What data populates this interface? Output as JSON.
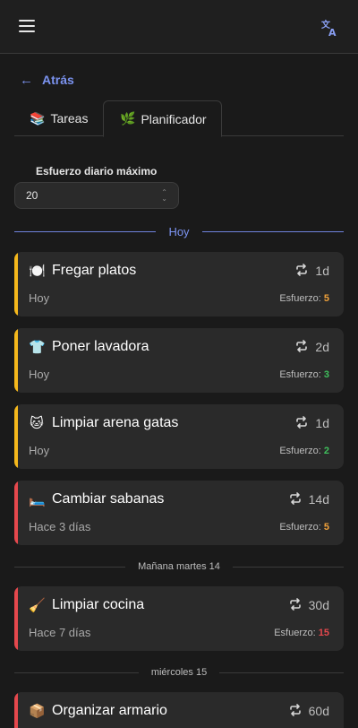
{
  "header": {
    "menu_icon": "hamburger-menu-icon",
    "translate_icon": "translate-icon"
  },
  "nav": {
    "back_label": "Atrás"
  },
  "tabs": [
    {
      "label": "Tareas",
      "icon": "books-icon"
    },
    {
      "label": "Planificador",
      "icon": "seedling-icon",
      "active": true
    }
  ],
  "effort": {
    "label": "Esfuerzo diario máximo",
    "value": "20"
  },
  "sections": [
    {
      "label": "Hoy"
    },
    {
      "label": "Mañana martes 14"
    },
    {
      "label": "miércoles 15"
    }
  ],
  "effort_prefix": "Esfuerzo:",
  "colors": {
    "accent": "#7b93f0",
    "bar_yellow": "#f5b81c",
    "bar_red": "#e5484d",
    "effort_orange": "#f0a13a",
    "effort_green": "#3fbf5c",
    "effort_red": "#e5484d"
  },
  "tasks": [
    {
      "emoji": "🍽️",
      "title": "Fregar platos",
      "freq": "1d",
      "when": "Hoy",
      "effort": "5",
      "bar": "#f5b81c",
      "effort_color": "#f0a13a"
    },
    {
      "emoji": "👕",
      "title": "Poner lavadora",
      "freq": "2d",
      "when": "Hoy",
      "effort": "3",
      "bar": "#f5b81c",
      "effort_color": "#3fbf5c"
    },
    {
      "emoji": "🐱",
      "title": "Limpiar arena gatas",
      "freq": "1d",
      "when": "Hoy",
      "effort": "2",
      "bar": "#f5b81c",
      "effort_color": "#3fbf5c"
    },
    {
      "emoji": "🛏️",
      "title": "Cambiar sabanas",
      "freq": "14d",
      "when": "Hace 3 días",
      "effort": "5",
      "bar": "#e5484d",
      "effort_color": "#f0a13a"
    },
    {
      "emoji": "🧹",
      "title": "Limpiar cocina",
      "freq": "30d",
      "when": "Hace 7 días",
      "effort": "15",
      "bar": "#e5484d",
      "effort_color": "#e5484d"
    },
    {
      "emoji": "📦",
      "title": "Organizar armario",
      "freq": "60d",
      "when": "",
      "effort": "",
      "bar": "#e5484d",
      "effort_color": "#f0a13a"
    }
  ]
}
